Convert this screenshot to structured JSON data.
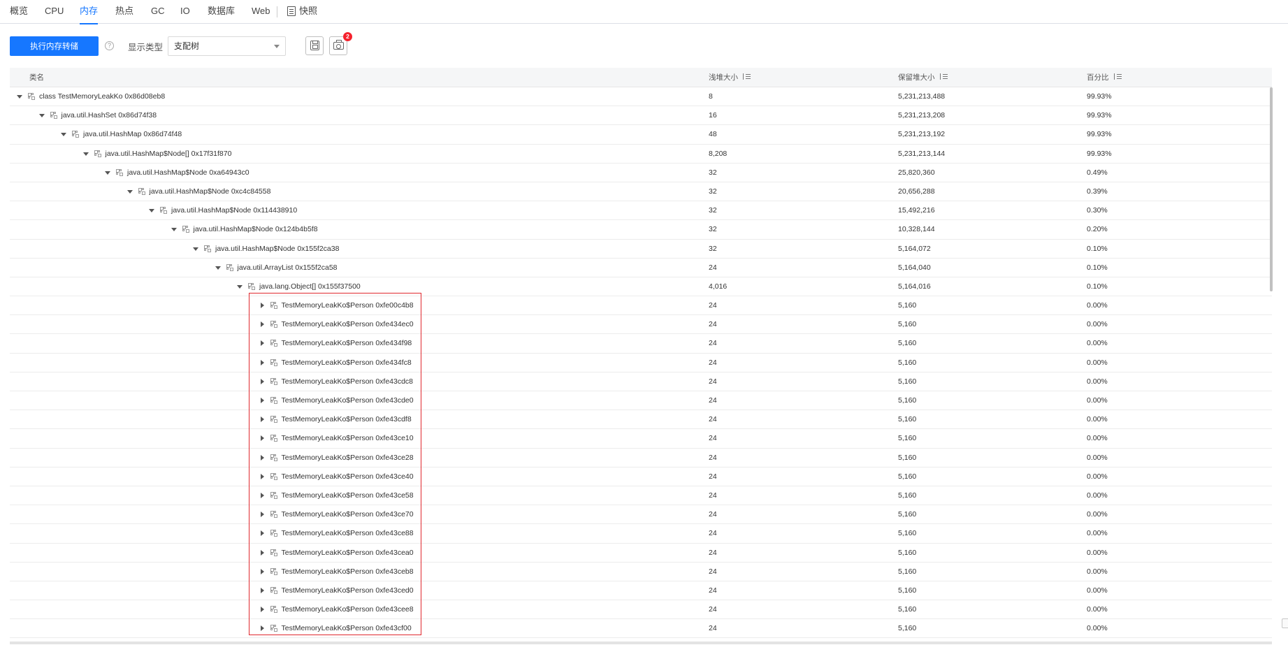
{
  "tabs": [
    {
      "label": "概览",
      "active": false
    },
    {
      "label": "CPU",
      "active": false
    },
    {
      "label": "内存",
      "active": true
    },
    {
      "label": "热点",
      "active": false
    },
    {
      "label": "GC",
      "active": false
    },
    {
      "label": "IO",
      "active": false
    },
    {
      "label": "数据库",
      "active": false
    },
    {
      "label": "Web",
      "active": false
    }
  ],
  "snapshot_tab": {
    "label": "快照",
    "icon": "document-icon"
  },
  "toolbar": {
    "dump_button": "执行内存转储",
    "help_icon": "?",
    "type_label": "显示类型",
    "type_select_value": "支配树",
    "save_icon": "save-icon",
    "snapshot_icon": "camera-icon",
    "snapshot_badge": "2"
  },
  "table": {
    "columns": [
      "类名",
      "浅堆大小",
      "保留堆大小",
      "百分比"
    ],
    "rows": [
      {
        "name": "class TestMemoryLeakKo 0x86d08eb8",
        "shallow": "8",
        "retained": "5,231,213,488",
        "percent": "99.93%",
        "expanded": true
      },
      {
        "name": "java.util.HashSet 0x86d74f38",
        "shallow": "16",
        "retained": "5,231,213,208",
        "percent": "99.93%",
        "expanded": true
      },
      {
        "name": "java.util.HashMap 0x86d74f48",
        "shallow": "48",
        "retained": "5,231,213,192",
        "percent": "99.93%",
        "expanded": true
      },
      {
        "name": "java.util.HashMap$Node[] 0x17f31f870",
        "shallow": "8,208",
        "retained": "5,231,213,144",
        "percent": "99.93%",
        "expanded": true
      },
      {
        "name": "java.util.HashMap$Node 0xa64943c0",
        "shallow": "32",
        "retained": "25,820,360",
        "percent": "0.49%",
        "expanded": true
      },
      {
        "name": "java.util.HashMap$Node 0xc4c84558",
        "shallow": "32",
        "retained": "20,656,288",
        "percent": "0.39%",
        "expanded": true
      },
      {
        "name": "java.util.HashMap$Node 0x114438910",
        "shallow": "32",
        "retained": "15,492,216",
        "percent": "0.30%",
        "expanded": true
      },
      {
        "name": "java.util.HashMap$Node 0x124b4b5f8",
        "shallow": "32",
        "retained": "10,328,144",
        "percent": "0.20%",
        "expanded": true
      },
      {
        "name": "java.util.HashMap$Node 0x155f2ca38",
        "shallow": "32",
        "retained": "5,164,072",
        "percent": "0.10%",
        "expanded": true
      },
      {
        "name": "java.util.ArrayList 0x155f2ca58",
        "shallow": "24",
        "retained": "5,164,040",
        "percent": "0.10%",
        "expanded": true
      },
      {
        "name": "java.lang.Object[] 0x155f37500",
        "shallow": "4,016",
        "retained": "5,164,016",
        "percent": "0.10%",
        "expanded": true
      },
      {
        "name": "TestMemoryLeakKo$Person 0xfe00c4b8",
        "shallow": "24",
        "retained": "5,160",
        "percent": "0.00%",
        "expanded": false
      },
      {
        "name": "TestMemoryLeakKo$Person 0xfe434ec0",
        "shallow": "24",
        "retained": "5,160",
        "percent": "0.00%",
        "expanded": false
      },
      {
        "name": "TestMemoryLeakKo$Person 0xfe434f98",
        "shallow": "24",
        "retained": "5,160",
        "percent": "0.00%",
        "expanded": false
      },
      {
        "name": "TestMemoryLeakKo$Person 0xfe434fc8",
        "shallow": "24",
        "retained": "5,160",
        "percent": "0.00%",
        "expanded": false
      },
      {
        "name": "TestMemoryLeakKo$Person 0xfe43cdc8",
        "shallow": "24",
        "retained": "5,160",
        "percent": "0.00%",
        "expanded": false
      },
      {
        "name": "TestMemoryLeakKo$Person 0xfe43cde0",
        "shallow": "24",
        "retained": "5,160",
        "percent": "0.00%",
        "expanded": false
      },
      {
        "name": "TestMemoryLeakKo$Person 0xfe43cdf8",
        "shallow": "24",
        "retained": "5,160",
        "percent": "0.00%",
        "expanded": false
      },
      {
        "name": "TestMemoryLeakKo$Person 0xfe43ce10",
        "shallow": "24",
        "retained": "5,160",
        "percent": "0.00%",
        "expanded": false
      },
      {
        "name": "TestMemoryLeakKo$Person 0xfe43ce28",
        "shallow": "24",
        "retained": "5,160",
        "percent": "0.00%",
        "expanded": false
      },
      {
        "name": "TestMemoryLeakKo$Person 0xfe43ce40",
        "shallow": "24",
        "retained": "5,160",
        "percent": "0.00%",
        "expanded": false
      },
      {
        "name": "TestMemoryLeakKo$Person 0xfe43ce58",
        "shallow": "24",
        "retained": "5,160",
        "percent": "0.00%",
        "expanded": false
      },
      {
        "name": "TestMemoryLeakKo$Person 0xfe43ce70",
        "shallow": "24",
        "retained": "5,160",
        "percent": "0.00%",
        "expanded": false
      },
      {
        "name": "TestMemoryLeakKo$Person 0xfe43ce88",
        "shallow": "24",
        "retained": "5,160",
        "percent": "0.00%",
        "expanded": false
      },
      {
        "name": "TestMemoryLeakKo$Person 0xfe43cea0",
        "shallow": "24",
        "retained": "5,160",
        "percent": "0.00%",
        "expanded": false
      },
      {
        "name": "TestMemoryLeakKo$Person 0xfe43ceb8",
        "shallow": "24",
        "retained": "5,160",
        "percent": "0.00%",
        "expanded": false
      },
      {
        "name": "TestMemoryLeakKo$Person 0xfe43ced0",
        "shallow": "24",
        "retained": "5,160",
        "percent": "0.00%",
        "expanded": false
      },
      {
        "name": "TestMemoryLeakKo$Person 0xfe43cee8",
        "shallow": "24",
        "retained": "5,160",
        "percent": "0.00%",
        "expanded": false
      },
      {
        "name": "TestMemoryLeakKo$Person 0xfe43cf00",
        "shallow": "24",
        "retained": "5,160",
        "percent": "0.00%",
        "expanded": false
      }
    ]
  },
  "colors": {
    "accent": "#1677ff",
    "highlight": "#e0282e",
    "badge": "#f5222d"
  }
}
